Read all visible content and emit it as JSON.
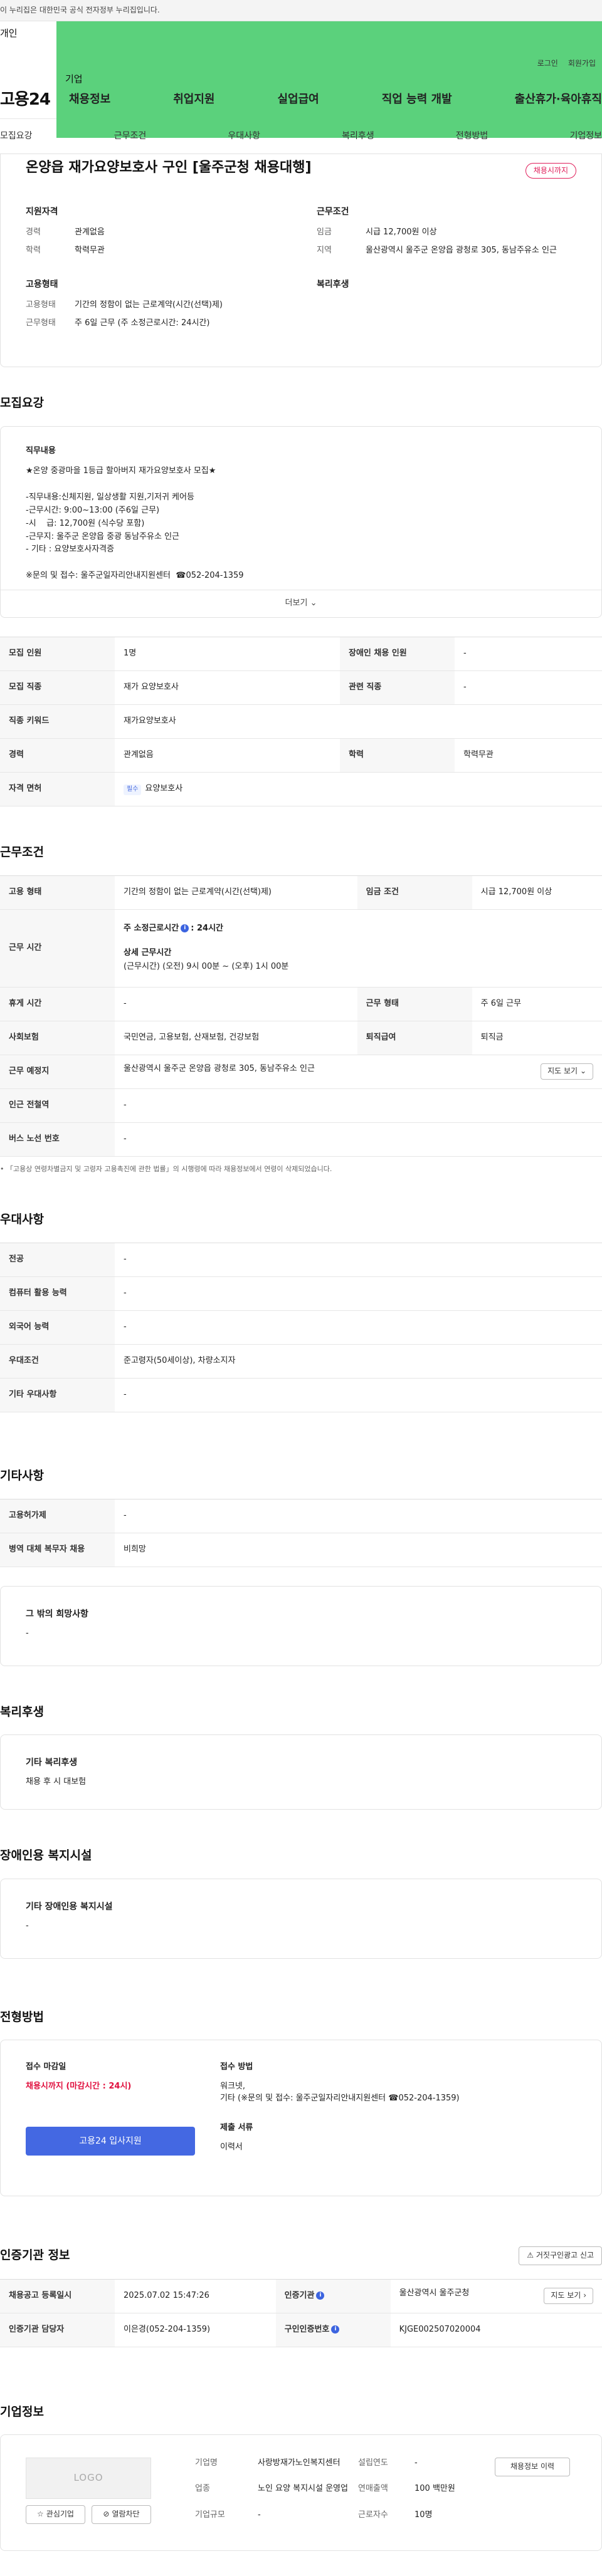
{
  "gov_banner": "이 누리집은 대한민국 공식 전자정부 누리집입니다.",
  "user_tabs": {
    "personal": "개인",
    "company": "기업"
  },
  "top_links": {
    "login": "로그인",
    "signup": "회원가입"
  },
  "logo": "고용24",
  "gnb": [
    "채용정보",
    "취업지원",
    "실업급여",
    "직업 능력 개발",
    "출산휴가·육아휴직"
  ],
  "subnav": [
    "모집요강",
    "근무조건",
    "우대사항",
    "복리후생",
    "전형방법",
    "기업정보"
  ],
  "job": {
    "title": "온양읍 재가요양보호사 구인 [울주군청 채용대행]",
    "badge": "채용시까지",
    "qual_title": "지원자격",
    "career_k": "경력",
    "career_v": "관계없음",
    "edu_k": "학력",
    "edu_v": "학력무관",
    "cond_title": "근무조건",
    "wage_k": "임금",
    "wage_v": "시급 12,700원 이상",
    "region_k": "지역",
    "region_v": "울산광역시 울주군 온양읍 광청로 305, 동남주유소 인근",
    "emp_title": "고용형태",
    "emptype_k": "고용형태",
    "emptype_v": "기간의 정함이 없는 근로계약(시간(선택)제)",
    "worktype_k": "근무형태",
    "worktype_v": "주 6일 근무 (주 소정근로시간: 24시간)",
    "welfare_title": "복리후생"
  },
  "recruit": {
    "title": "모집요강",
    "duty_title": "직무내용",
    "lines": [
      "★온양 중광마을 1등급 할아버지 재가요양보호사 모집★",
      "",
      "-직무내용:신체지원, 일상생활 지원,기저귀 케어등",
      "-근무시간: 9:00~13:00 (주6일 근무)",
      "-시    급: 12,700원 (식수당 포함)",
      "-근무지: 울주군 온양읍 중광 동남주유소 인근",
      "- 기타 : 요양보호사자격증",
      "",
      "※문의 및 접수: 울주군일자리안내지원센터  ☎052-204-1359"
    ],
    "more": "더보기",
    "rows": [
      {
        "k1": "모집 인원",
        "v1": "1명",
        "k2": "장애인 채용 인원",
        "v2": "-"
      },
      {
        "k1": "모집 직종",
        "v1": "재가 요양보호사",
        "k2": "관련 직종",
        "v2": "-"
      },
      {
        "k1": "직종 키워드",
        "v1": "재가요양보호사"
      },
      {
        "k1": "경력",
        "v1": "관계없음",
        "k2": "학력",
        "v2": "학력무관"
      }
    ],
    "license_k": "자격 면허",
    "license_tag": "필수",
    "license_v": "요양보호사"
  },
  "conditions": {
    "title": "근무조건",
    "emp_k": "고용 형태",
    "emp_v": "기간의 정함이 없는 근로계약(시간(선택)제)",
    "wage_k": "임금 조건",
    "wage_v": "시급 12,700원 이상",
    "time_k": "근무 시간",
    "weekly_title": "주 소정근로시간",
    "weekly_v": ": 24시간",
    "detail_title": "상세 근무시간",
    "detail_v": "(근무시간) (오전) 9시 00분 ~ (오후) 1시 00분",
    "holiday_k": "휴게 시간",
    "holiday_v": "-",
    "workform_k": "근무 형태",
    "workform_v": "주 6일 근무",
    "insurance_k": "사회보험",
    "insurance_v": "국민연금, 고용보험, 산재보험, 건강보험",
    "severance_k": "퇴직급여",
    "severance_v": "퇴직금",
    "place_k": "근무 예정지",
    "place_v": "울산광역시 울주군 온양읍 광청로 305, 동남주유소 인근",
    "map_btn": "지도 보기",
    "subway_k": "인근 전철역",
    "subway_v": "-",
    "bus_k": "버스 노선 번호",
    "bus_v": "-",
    "note": "「고용상 연령차별금지 및 고령자 고용촉진에 관한 법률」의 시행령에 따라 채용정보에서 연령이 삭제되었습니다."
  },
  "preference": {
    "title": "우대사항",
    "rows": [
      {
        "k": "전공",
        "v": "-"
      },
      {
        "k": "컴퓨터 활용 능력",
        "v": "-"
      },
      {
        "k": "외국어 능력",
        "v": "-"
      },
      {
        "k": "우대조건",
        "v": "준고령자(50세이상), 차량소지자"
      },
      {
        "k": "기타 우대사항",
        "v": "-"
      }
    ]
  },
  "etc": {
    "title": "기타사항",
    "rows": [
      {
        "k": "고용허가제",
        "v": "-"
      },
      {
        "k": "병역 대체 복무자 채용",
        "v": "비희망"
      }
    ],
    "other_title": "그 밖의 희망사항",
    "other_v": "-"
  },
  "welfare": {
    "title": "복리후생",
    "box_title": "기타 복리후생",
    "box_v": "채용 후 시 대보험"
  },
  "disabled": {
    "title": "장애인용 복지시설",
    "box_title": "기타 장애인용 복지시설",
    "box_v": "-"
  },
  "selection": {
    "title": "전형방법",
    "deadline_title": "접수 마감일",
    "deadline_v": "채용시까지 (마감시간 : 24시)",
    "apply_btn": "고용24 입사지원",
    "method_title": "접수 방법",
    "method_1": "워크넷,",
    "method_2": "기타 (※문의 및 접수: 울주군일자리안내지원센터  ☎052-204-1359)",
    "docs_title": "제출 서류",
    "docs_v": "이력서"
  },
  "cert": {
    "title": "인증기관 정보",
    "report_btn": "거짓구인광고 신고",
    "reg_k": "채용공고 등록일시",
    "reg_v": "2025.07.02 15:47:26",
    "org_k": "인증기관",
    "org_v": "울산광역시 울주군청",
    "map_btn": "지도 보기",
    "mgr_k": "인증기관 담당자",
    "mgr_v": "이은경(052-204-1359)",
    "num_k": "구인인증번호",
    "num_v": "KJGE002507020004"
  },
  "company": {
    "title": "기업정보",
    "logo": "LOGO",
    "fav_btn": "관심기업",
    "block_btn": "열람차단",
    "name_k": "기업명",
    "name_v": "사랑방재가노인복지센터",
    "year_k": "설립연도",
    "year_v": "-",
    "industry_k": "업종",
    "industry_v": "노인 요양 복지시설 운영업",
    "sales_k": "연매출액",
    "sales_v": "100 백만원",
    "workers_k": "근로자수",
    "workers_v": "10명",
    "scale_k": "기업규모",
    "scale_v": "-",
    "detail_btn": "채용정보 이력"
  }
}
